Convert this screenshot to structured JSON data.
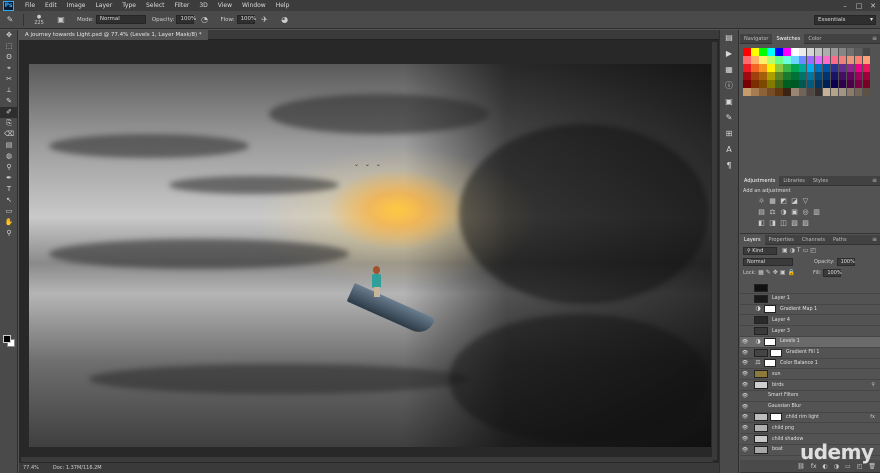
{
  "menubar": {
    "logo": "Ps",
    "items": [
      "File",
      "Edit",
      "Image",
      "Layer",
      "Type",
      "Select",
      "Filter",
      "3D",
      "View",
      "Window",
      "Help"
    ],
    "controls": [
      "–",
      "□",
      "✕"
    ]
  },
  "options": {
    "brush_size": "225",
    "mode_label": "Mode:",
    "mode_value": "Normal",
    "opacity_label": "Opacity:",
    "opacity_value": "100%",
    "flow_label": "Flow:",
    "flow_value": "100%",
    "workspace": "Essentials"
  },
  "document": {
    "tab_title": "A journey towards Light.psd @ 77.4% (Levels 1, Layer Mask/8) *",
    "zoom": "77.4%",
    "doc_size": "Doc: 1.37M/116.2M"
  },
  "swatches_panel": {
    "tabs": [
      "Navigator",
      "Swatches",
      "Color"
    ],
    "active_tab": "Swatches",
    "colors": [
      "#ff0000",
      "#ffff00",
      "#00ff00",
      "#00ffff",
      "#0000ff",
      "#ff00ff",
      "#ffffff",
      "#ebebeb",
      "#d6d6d6",
      "#c2c2c2",
      "#adadad",
      "#999999",
      "#858585",
      "#707070",
      "#5c5c5c",
      "#474747",
      "#ff6b6b",
      "#ffb06b",
      "#fff06b",
      "#b6ff6b",
      "#6bff8a",
      "#6bffe0",
      "#6bd4ff",
      "#6b8cff",
      "#9a6bff",
      "#e06bff",
      "#ff6bc9",
      "#ff6b8c",
      "#f08080",
      "#e9967a",
      "#fa8072",
      "#ffa07a",
      "#ed1c24",
      "#f26522",
      "#f7941d",
      "#fff200",
      "#8dc63f",
      "#39b54a",
      "#00a651",
      "#00a99d",
      "#00aeef",
      "#0072bc",
      "#0054a6",
      "#2e3192",
      "#662d91",
      "#92278f",
      "#ec008c",
      "#ed145b",
      "#9e0b0f",
      "#a0410d",
      "#a36209",
      "#aba000",
      "#598527",
      "#197b30",
      "#007236",
      "#00746b",
      "#0076a3",
      "#004a80",
      "#003471",
      "#1b1464",
      "#440e62",
      "#630460",
      "#9e005d",
      "#9e0039",
      "#790000",
      "#7b2e00",
      "#7d4900",
      "#827b00",
      "#406618",
      "#005e20",
      "#005826",
      "#005952",
      "#005b7f",
      "#003663",
      "#002157",
      "#0d004c",
      "#32004b",
      "#4b0049",
      "#7b0046",
      "#7a0026",
      "#c69c6d",
      "#a67c52",
      "#8c6239",
      "#754c24",
      "#603913",
      "#3c2415",
      "#998675",
      "#736357",
      "#534741",
      "#362f2d",
      "#c7b299",
      "#b5a48c",
      "#a39584",
      "#8c7b6b",
      "#756656",
      "#5e5245"
    ]
  },
  "adjustments_panel": {
    "tabs": [
      "Adjustments",
      "Libraries",
      "Styles"
    ],
    "active_tab": "Adjustments",
    "title": "Add an adjustment",
    "row1": [
      "☼",
      "▦",
      "◩",
      "◪",
      "▽"
    ],
    "row2": [
      "▤",
      "⚖",
      "◑",
      "▣",
      "◎",
      "▥"
    ],
    "row3": [
      "◧",
      "◨",
      "◫",
      "▧",
      "▨"
    ]
  },
  "layers_panel": {
    "tabs": [
      "Layers",
      "Properties",
      "Channels",
      "Paths"
    ],
    "active_tab": "Layers",
    "filter_kind": "Kind",
    "blend_mode": "Normal",
    "opacity_label": "Opacity:",
    "opacity_value": "100%",
    "lock_label": "Lock:",
    "fill_label": "Fill:",
    "fill_value": "100%",
    "footer_icons": [
      "⛓",
      "fx",
      "◐",
      "◑",
      "▭",
      "◰",
      "🗑"
    ],
    "rows": [
      {
        "name": "",
        "visible": false,
        "selected": false,
        "sub": false,
        "thumb": "#111111",
        "mask": false,
        "adj": "",
        "fx": ""
      },
      {
        "name": "Layer 1",
        "visible": false,
        "selected": false,
        "sub": false,
        "thumb": "#1a1a1a",
        "mask": false,
        "adj": "",
        "fx": ""
      },
      {
        "name": "Gradient Map 1",
        "visible": false,
        "selected": false,
        "sub": false,
        "thumb": "",
        "mask": true,
        "adj": "◑",
        "fx": ""
      },
      {
        "name": "Layer 4",
        "visible": false,
        "selected": false,
        "sub": false,
        "thumb": "#2a2a2a",
        "mask": false,
        "adj": "",
        "fx": ""
      },
      {
        "name": "Layer 3",
        "visible": false,
        "selected": false,
        "sub": false,
        "thumb": "#3a3a3a",
        "mask": false,
        "adj": "",
        "fx": ""
      },
      {
        "name": "Levels 1",
        "visible": true,
        "selected": true,
        "sub": false,
        "thumb": "",
        "mask": true,
        "adj": "◑",
        "fx": ""
      },
      {
        "name": "Gradient Fill 1",
        "visible": true,
        "selected": false,
        "sub": false,
        "thumb": "#444444",
        "mask": true,
        "adj": "",
        "fx": ""
      },
      {
        "name": "Color Balance 1",
        "visible": true,
        "selected": false,
        "sub": false,
        "thumb": "",
        "mask": true,
        "adj": "⚖",
        "fx": ""
      },
      {
        "name": "sun",
        "visible": true,
        "selected": false,
        "sub": false,
        "thumb": "#8b7a3a",
        "mask": false,
        "adj": "",
        "fx": ""
      },
      {
        "name": "birds",
        "visible": true,
        "selected": false,
        "sub": false,
        "thumb": "#cfcfcf",
        "mask": false,
        "adj": "",
        "fx": "⚲"
      },
      {
        "name": "Smart Filters",
        "visible": true,
        "selected": false,
        "sub": true,
        "thumb": "",
        "mask": false,
        "adj": "",
        "fx": ""
      },
      {
        "name": "Gaussian Blur",
        "visible": true,
        "selected": false,
        "sub": true,
        "thumb": "",
        "mask": false,
        "adj": "",
        "fx": ""
      },
      {
        "name": "child rim light",
        "visible": true,
        "selected": false,
        "sub": false,
        "thumb": "#bdbdbd",
        "mask": true,
        "adj": "",
        "fx": "fx"
      },
      {
        "name": "child png",
        "visible": true,
        "selected": false,
        "sub": false,
        "thumb": "#b0b0b0",
        "mask": false,
        "adj": "",
        "fx": ""
      },
      {
        "name": "child shadow",
        "visible": true,
        "selected": false,
        "sub": false,
        "thumb": "#c8c8c8",
        "mask": false,
        "adj": "",
        "fx": ""
      },
      {
        "name": "boat",
        "visible": true,
        "selected": false,
        "sub": false,
        "thumb": "#a8a8a8",
        "mask": false,
        "adj": "",
        "fx": ""
      }
    ]
  },
  "tools": [
    "✥",
    "⬚",
    "ʘ",
    "⌖",
    "✂",
    "⟂",
    "✎",
    "✐",
    "⎘",
    "⌫",
    "▤",
    "◍",
    "⚲",
    "✒",
    "T",
    "↖",
    "▭",
    "✋",
    "⚲"
  ],
  "right_strip_icons": [
    "▤",
    "▶",
    "▦",
    "ⓘ",
    "▣",
    "✎",
    "⊞",
    "A",
    "¶"
  ],
  "watermark": "udemy"
}
